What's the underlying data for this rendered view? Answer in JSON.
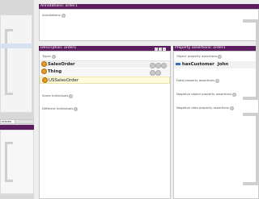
{
  "annotations_panel": {
    "title": "Annotations: order1",
    "annotations_label": "Annotations"
  },
  "description_panel": {
    "title": "Description: order1",
    "types_label": "Types",
    "types": [
      {
        "label": "SalesOrder"
      },
      {
        "label": "Thing"
      },
      {
        "label": "USSalesOrder"
      }
    ],
    "same_individuals_label": "Same Individuals",
    "different_individuals_label": "Different Individuals"
  },
  "property_panel": {
    "title": "Property assertions: order1",
    "object_property_assertions_label": "Object property assertions",
    "assertion": {
      "property": "hasCustomer",
      "value": "John"
    },
    "data_property_assertions_label": "Data property assertions",
    "negative_object_property_assertions_label": "Negative object property assertions",
    "negative_data_property_assertions_label": "Negative data property assertions"
  },
  "left_panel": {
    "tab_label": "rences"
  },
  "colors": {
    "header_purple": "#5d1e5f",
    "type_dot": "#e39a27",
    "inferred_row": "#fffbdd",
    "selected_row": "#d7e1f0"
  }
}
